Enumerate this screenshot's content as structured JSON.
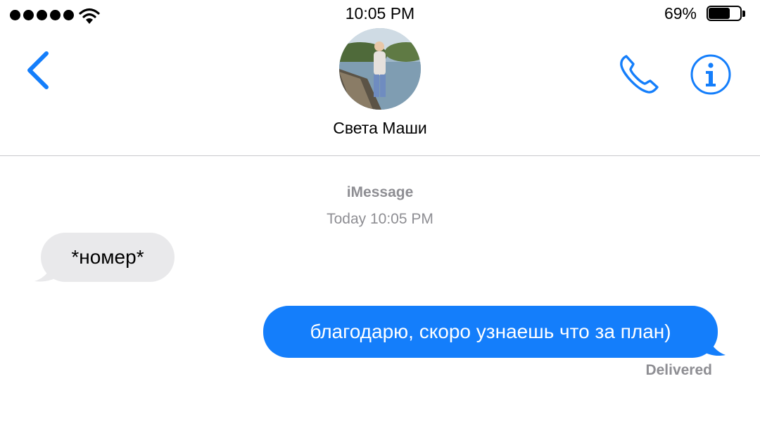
{
  "status_bar": {
    "time": "10:05 PM",
    "battery_percent": "69%",
    "battery_level": 0.69,
    "signal_bars": 5,
    "icons": [
      "signal-dots-icon",
      "wifi-icon",
      "battery-icon"
    ]
  },
  "header": {
    "contact_name": "Света Маши",
    "back_icon": "chevron-left-icon",
    "call_icon": "phone-icon",
    "info_icon": "info-icon",
    "accent_color": "#147efb"
  },
  "conversation": {
    "service": "iMessage",
    "timestamp": "Today 10:05 PM",
    "messages": [
      {
        "direction": "incoming",
        "text": "*номер*",
        "bubble_color": "#e9e9eb"
      },
      {
        "direction": "outgoing",
        "text": "благодарю, скоро узнаешь что за план)",
        "bubble_color": "#147efb"
      }
    ],
    "delivery_status": "Delivered"
  }
}
